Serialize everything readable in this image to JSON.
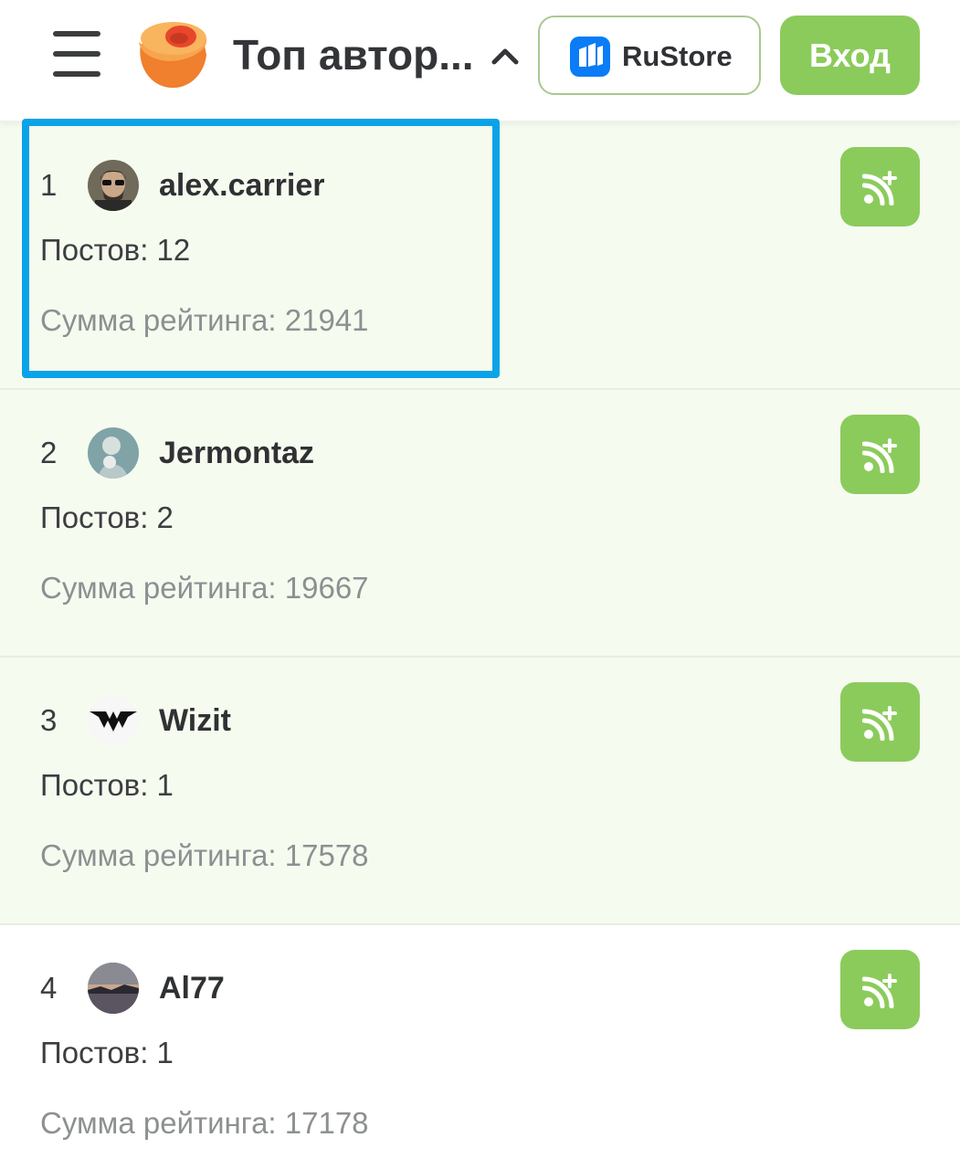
{
  "header": {
    "title": "Топ автор...",
    "rustore_label": "RuStore",
    "login_label": "Вход",
    "icons": [
      "menu-icon",
      "app-logo-icon",
      "chevron-up-icon",
      "rustore-icon"
    ]
  },
  "authors": [
    {
      "rank": "1",
      "name": "alex.carrier",
      "posts": "Постов: 12",
      "rating": "Сумма рейтинга: 21941"
    },
    {
      "rank": "2",
      "name": "Jermontaz",
      "posts": "Постов: 2",
      "rating": "Сумма рейтинга: 19667"
    },
    {
      "rank": "3",
      "name": "Wizit",
      "posts": "Постов: 1",
      "rating": "Сумма рейтинга: 17578"
    },
    {
      "rank": "4",
      "name": "Al77",
      "posts": "Постов: 1",
      "rating": "Сумма рейтинга: 17178"
    }
  ],
  "colors": {
    "accent": "#8bcb5b",
    "row_background": "#f6fbf0",
    "highlight": "#0aa3e8",
    "logo": "#f07f2e"
  },
  "subscribe_icon": "subscribe-rss-plus-icon"
}
